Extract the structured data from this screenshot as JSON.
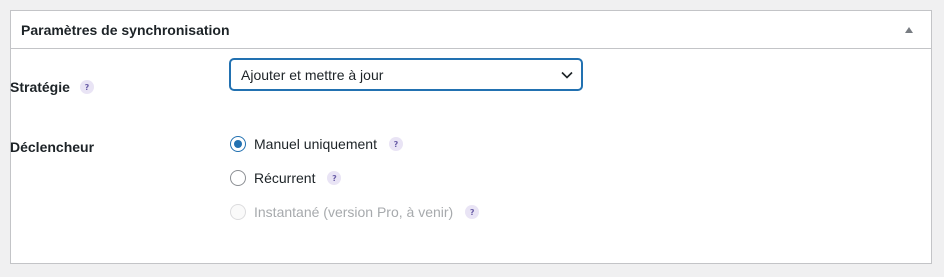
{
  "panel": {
    "title": "Paramètres de synchronisation",
    "toggle_icon": "triangle-up-icon"
  },
  "strategy": {
    "label": "Stratégie",
    "help": "?",
    "selected": "Ajouter et mettre à jour"
  },
  "trigger": {
    "label": "Déclencheur",
    "options": [
      {
        "label": "Manuel uniquement",
        "help": "?",
        "checked": true,
        "disabled": false
      },
      {
        "label": "Récurrent",
        "help": "?",
        "checked": false,
        "disabled": false
      },
      {
        "label": "Instantané (version Pro, à venir)",
        "help": "?",
        "checked": false,
        "disabled": true
      }
    ]
  },
  "colors": {
    "accent": "#2271b1",
    "border": "#c3c4c7",
    "background": "#f0f0f1",
    "help_bg": "#e9e4f5",
    "disabled_text": "#a7aaad"
  }
}
